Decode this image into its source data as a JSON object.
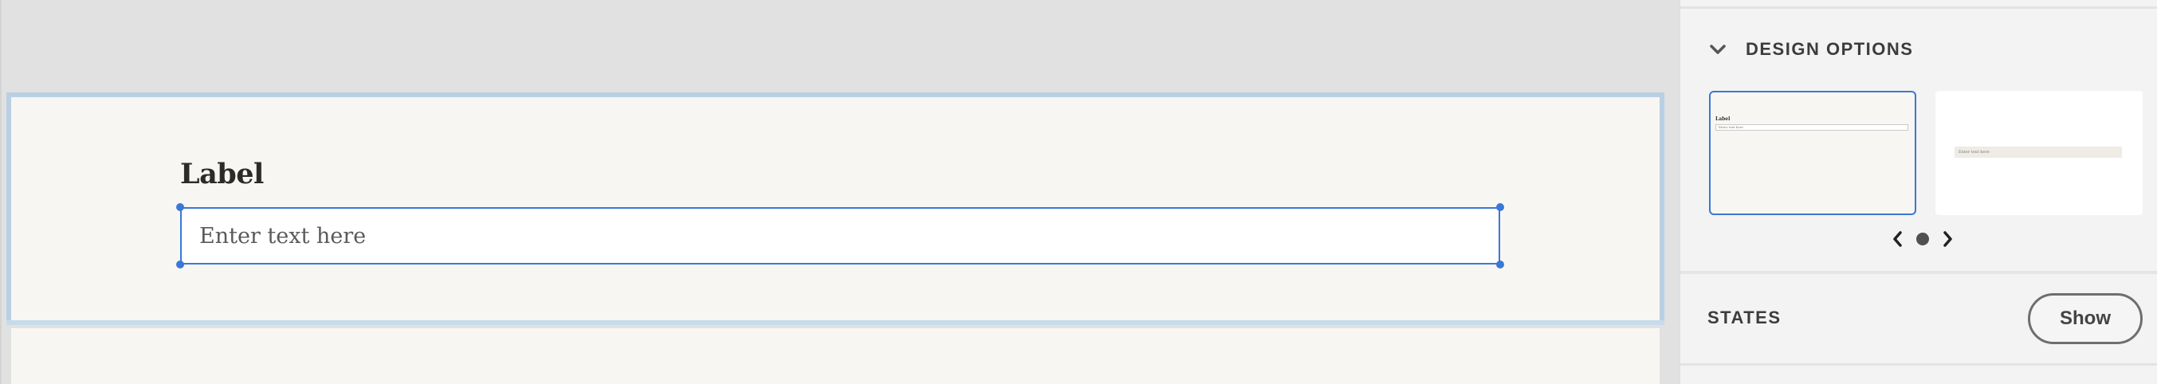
{
  "canvas": {
    "field": {
      "label": "Label",
      "placeholder": "Enter text here"
    }
  },
  "panel": {
    "design_options": {
      "title": "DESIGN OPTIONS",
      "toggle_icon": "chevron-down-icon",
      "options": [
        {
          "label": "Label",
          "placeholder": "Enter text here",
          "selected": true
        },
        {
          "placeholder": "Enter text here",
          "selected": false
        }
      ],
      "carousel": {
        "prev_icon": "chevron-left-icon",
        "next_icon": "chevron-right-icon",
        "page_count": 1,
        "current_page": 1
      }
    },
    "states": {
      "title": "STATES",
      "show_label": "Show"
    }
  },
  "colors": {
    "selection_accent": "#3a78d6",
    "section_highlight": "#b9cfe4",
    "canvas_background": "#e1e1e1",
    "section_background": "#f7f6f2",
    "panel_background": "#f3f3f3"
  }
}
